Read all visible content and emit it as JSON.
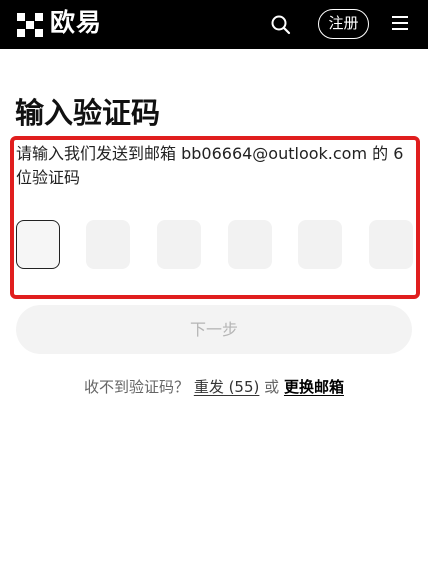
{
  "header": {
    "brand": "欧易",
    "register_label": "注册",
    "icons": {
      "logo": "okx-logo",
      "search": "search-icon",
      "menu": "hamburger-menu-icon"
    }
  },
  "page": {
    "title": "输入验证码",
    "instruction": "请输入我们发送到邮箱 bb06664@outlook.com 的 6 位验证码"
  },
  "code_inputs": [
    "",
    "",
    "",
    "",
    "",
    ""
  ],
  "actions": {
    "next_label": "下一步"
  },
  "resend": {
    "prompt": "收不到验证码？",
    "resend_label": "重发 (55)",
    "or": "或",
    "change_email_label": "更换邮箱"
  },
  "colors": {
    "header_bg": "#000000",
    "highlight_border": "#e01e1e",
    "disabled_button_bg": "#f3f3f3",
    "disabled_button_text": "#b5b5b5"
  }
}
